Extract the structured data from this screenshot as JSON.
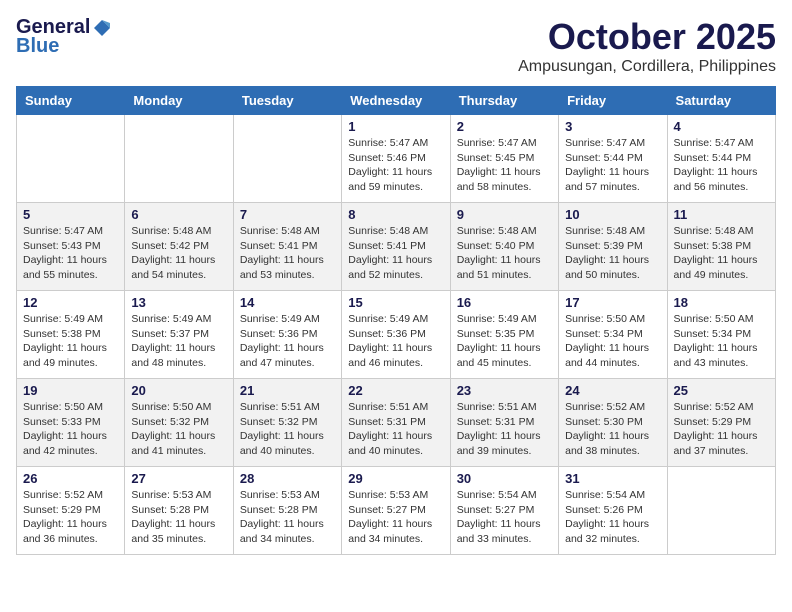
{
  "logo": {
    "line1": "General",
    "line2": "Blue"
  },
  "header": {
    "month": "October 2025",
    "location": "Ampusungan, Cordillera, Philippines"
  },
  "weekdays": [
    "Sunday",
    "Monday",
    "Tuesday",
    "Wednesday",
    "Thursday",
    "Friday",
    "Saturday"
  ],
  "weeks": [
    [
      {
        "day": "",
        "info": ""
      },
      {
        "day": "",
        "info": ""
      },
      {
        "day": "",
        "info": ""
      },
      {
        "day": "1",
        "info": "Sunrise: 5:47 AM\nSunset: 5:46 PM\nDaylight: 11 hours\nand 59 minutes."
      },
      {
        "day": "2",
        "info": "Sunrise: 5:47 AM\nSunset: 5:45 PM\nDaylight: 11 hours\nand 58 minutes."
      },
      {
        "day": "3",
        "info": "Sunrise: 5:47 AM\nSunset: 5:44 PM\nDaylight: 11 hours\nand 57 minutes."
      },
      {
        "day": "4",
        "info": "Sunrise: 5:47 AM\nSunset: 5:44 PM\nDaylight: 11 hours\nand 56 minutes."
      }
    ],
    [
      {
        "day": "5",
        "info": "Sunrise: 5:47 AM\nSunset: 5:43 PM\nDaylight: 11 hours\nand 55 minutes."
      },
      {
        "day": "6",
        "info": "Sunrise: 5:48 AM\nSunset: 5:42 PM\nDaylight: 11 hours\nand 54 minutes."
      },
      {
        "day": "7",
        "info": "Sunrise: 5:48 AM\nSunset: 5:41 PM\nDaylight: 11 hours\nand 53 minutes."
      },
      {
        "day": "8",
        "info": "Sunrise: 5:48 AM\nSunset: 5:41 PM\nDaylight: 11 hours\nand 52 minutes."
      },
      {
        "day": "9",
        "info": "Sunrise: 5:48 AM\nSunset: 5:40 PM\nDaylight: 11 hours\nand 51 minutes."
      },
      {
        "day": "10",
        "info": "Sunrise: 5:48 AM\nSunset: 5:39 PM\nDaylight: 11 hours\nand 50 minutes."
      },
      {
        "day": "11",
        "info": "Sunrise: 5:48 AM\nSunset: 5:38 PM\nDaylight: 11 hours\nand 49 minutes."
      }
    ],
    [
      {
        "day": "12",
        "info": "Sunrise: 5:49 AM\nSunset: 5:38 PM\nDaylight: 11 hours\nand 49 minutes."
      },
      {
        "day": "13",
        "info": "Sunrise: 5:49 AM\nSunset: 5:37 PM\nDaylight: 11 hours\nand 48 minutes."
      },
      {
        "day": "14",
        "info": "Sunrise: 5:49 AM\nSunset: 5:36 PM\nDaylight: 11 hours\nand 47 minutes."
      },
      {
        "day": "15",
        "info": "Sunrise: 5:49 AM\nSunset: 5:36 PM\nDaylight: 11 hours\nand 46 minutes."
      },
      {
        "day": "16",
        "info": "Sunrise: 5:49 AM\nSunset: 5:35 PM\nDaylight: 11 hours\nand 45 minutes."
      },
      {
        "day": "17",
        "info": "Sunrise: 5:50 AM\nSunset: 5:34 PM\nDaylight: 11 hours\nand 44 minutes."
      },
      {
        "day": "18",
        "info": "Sunrise: 5:50 AM\nSunset: 5:34 PM\nDaylight: 11 hours\nand 43 minutes."
      }
    ],
    [
      {
        "day": "19",
        "info": "Sunrise: 5:50 AM\nSunset: 5:33 PM\nDaylight: 11 hours\nand 42 minutes."
      },
      {
        "day": "20",
        "info": "Sunrise: 5:50 AM\nSunset: 5:32 PM\nDaylight: 11 hours\nand 41 minutes."
      },
      {
        "day": "21",
        "info": "Sunrise: 5:51 AM\nSunset: 5:32 PM\nDaylight: 11 hours\nand 40 minutes."
      },
      {
        "day": "22",
        "info": "Sunrise: 5:51 AM\nSunset: 5:31 PM\nDaylight: 11 hours\nand 40 minutes."
      },
      {
        "day": "23",
        "info": "Sunrise: 5:51 AM\nSunset: 5:31 PM\nDaylight: 11 hours\nand 39 minutes."
      },
      {
        "day": "24",
        "info": "Sunrise: 5:52 AM\nSunset: 5:30 PM\nDaylight: 11 hours\nand 38 minutes."
      },
      {
        "day": "25",
        "info": "Sunrise: 5:52 AM\nSunset: 5:29 PM\nDaylight: 11 hours\nand 37 minutes."
      }
    ],
    [
      {
        "day": "26",
        "info": "Sunrise: 5:52 AM\nSunset: 5:29 PM\nDaylight: 11 hours\nand 36 minutes."
      },
      {
        "day": "27",
        "info": "Sunrise: 5:53 AM\nSunset: 5:28 PM\nDaylight: 11 hours\nand 35 minutes."
      },
      {
        "day": "28",
        "info": "Sunrise: 5:53 AM\nSunset: 5:28 PM\nDaylight: 11 hours\nand 34 minutes."
      },
      {
        "day": "29",
        "info": "Sunrise: 5:53 AM\nSunset: 5:27 PM\nDaylight: 11 hours\nand 34 minutes."
      },
      {
        "day": "30",
        "info": "Sunrise: 5:54 AM\nSunset: 5:27 PM\nDaylight: 11 hours\nand 33 minutes."
      },
      {
        "day": "31",
        "info": "Sunrise: 5:54 AM\nSunset: 5:26 PM\nDaylight: 11 hours\nand 32 minutes."
      },
      {
        "day": "",
        "info": ""
      }
    ]
  ]
}
